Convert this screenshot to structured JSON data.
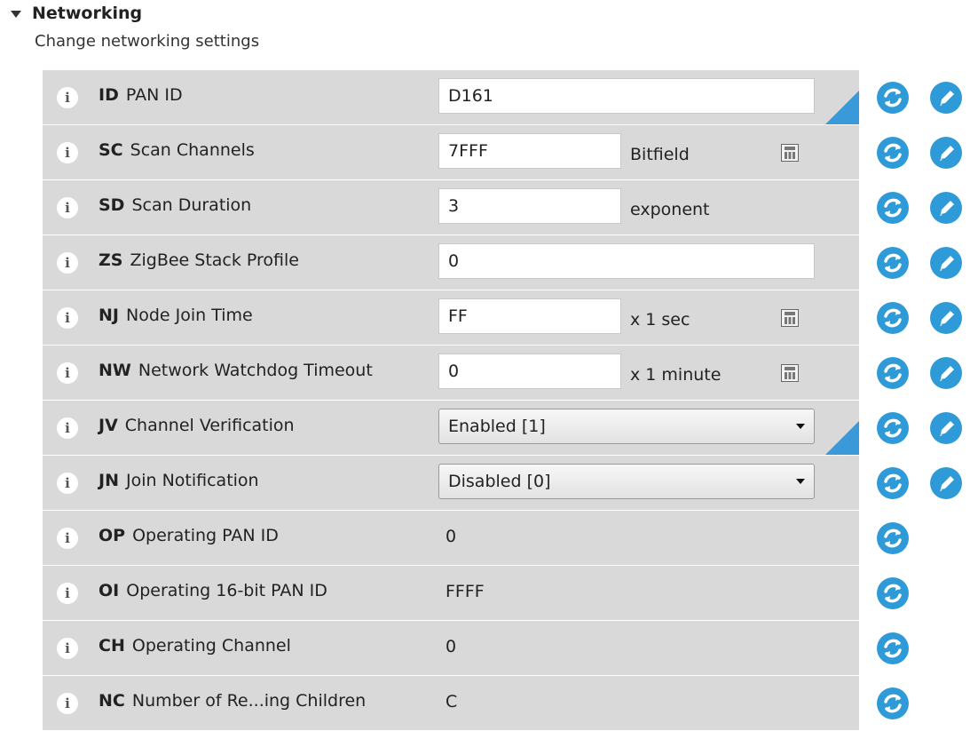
{
  "section": {
    "title": "Networking",
    "subtitle": "Change networking settings"
  },
  "rows": [
    {
      "code": "ID",
      "name": "PAN ID",
      "kind": "input",
      "value": "D161",
      "modified": true
    },
    {
      "code": "SC",
      "name": "Scan Channels",
      "kind": "input-unit",
      "value": "7FFF",
      "unit": "Bitfield",
      "calculator": true
    },
    {
      "code": "SD",
      "name": "Scan Duration",
      "kind": "input-unit",
      "value": "3",
      "unit": "exponent"
    },
    {
      "code": "ZS",
      "name": "ZigBee Stack Profile",
      "kind": "input",
      "value": "0"
    },
    {
      "code": "NJ",
      "name": "Node Join Time",
      "kind": "input-unit",
      "value": "FF",
      "unit": "x 1 sec",
      "calculator": true
    },
    {
      "code": "NW",
      "name": "Network Watchdog Timeout",
      "kind": "input-unit",
      "value": "0",
      "unit": "x 1 minute",
      "calculator": true
    },
    {
      "code": "JV",
      "name": "Channel Verification",
      "kind": "select",
      "value": "Enabled [1]",
      "modified": true
    },
    {
      "code": "JN",
      "name": "Join Notification",
      "kind": "select",
      "value": "Disabled [0]"
    },
    {
      "code": "OP",
      "name": "Operating PAN ID",
      "kind": "readonly",
      "value": "0"
    },
    {
      "code": "OI",
      "name": "Operating 16-bit PAN ID",
      "kind": "readonly",
      "value": "FFFF"
    },
    {
      "code": "CH",
      "name": "Operating Channel",
      "kind": "readonly",
      "value": "0"
    },
    {
      "code": "NC",
      "name": "Number of Re...ing Children",
      "kind": "readonly",
      "value": "C"
    }
  ],
  "icons": {
    "info": "info-icon",
    "refresh": "refresh-icon",
    "write": "write-icon",
    "calculator": "calculator-icon",
    "expand": "triangle-down-icon"
  },
  "colors": {
    "row_bg": "#d9d9d9",
    "accent": "#2f9ad8"
  }
}
